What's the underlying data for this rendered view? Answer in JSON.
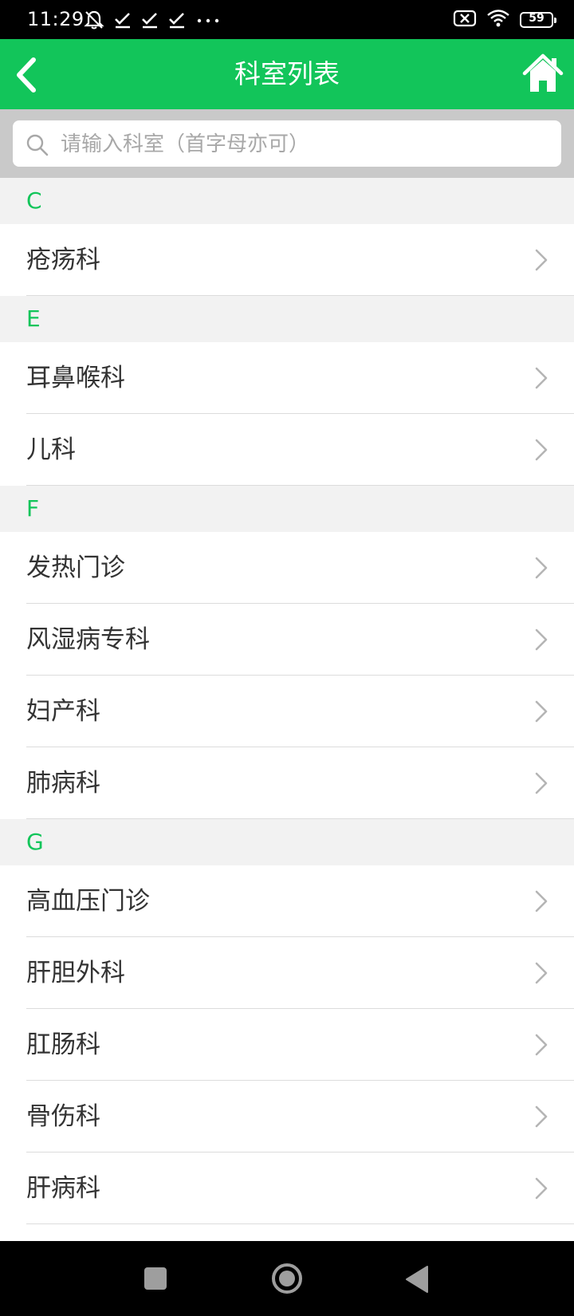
{
  "status_bar": {
    "time": "11:29",
    "battery": "59",
    "icons": [
      "mute-icon",
      "check-icon",
      "check-icon",
      "check-icon",
      "more-icon",
      "sim-off-icon",
      "wifi-icon",
      "battery-icon"
    ]
  },
  "header": {
    "title": "科室列表",
    "background": "#12c55a"
  },
  "search": {
    "placeholder": "请输入科室（首字母亦可）",
    "value": ""
  },
  "sections": [
    {
      "letter": "C",
      "items": [
        "疮疡科"
      ]
    },
    {
      "letter": "E",
      "items": [
        "耳鼻喉科",
        "儿科"
      ]
    },
    {
      "letter": "F",
      "items": [
        "发热门诊",
        "风湿病专科",
        "妇产科",
        "肺病科"
      ]
    },
    {
      "letter": "G",
      "items": [
        "高血压门诊",
        "肝胆外科",
        "肛肠科",
        "骨伤科",
        "肝病科"
      ]
    }
  ],
  "colors": {
    "accent": "#12c55a",
    "section_bg": "#f2f2f2",
    "text": "#333333"
  }
}
